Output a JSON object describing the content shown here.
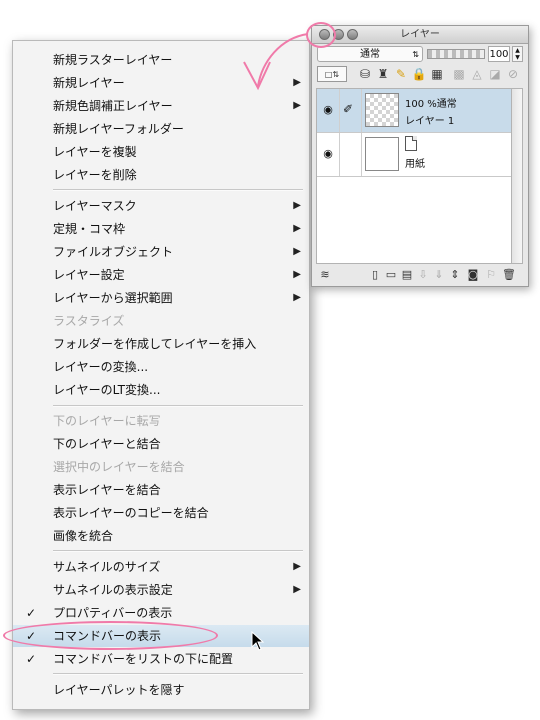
{
  "menu": {
    "items": [
      {
        "label": "新規ラスターレイヤー",
        "submenu": false,
        "disabled": false,
        "checked": false
      },
      {
        "label": "新規レイヤー",
        "submenu": true,
        "disabled": false,
        "checked": false
      },
      {
        "label": "新規色調補正レイヤー",
        "submenu": true,
        "disabled": false,
        "checked": false
      },
      {
        "label": "新規レイヤーフォルダー",
        "submenu": false,
        "disabled": false,
        "checked": false
      },
      {
        "label": "レイヤーを複製",
        "submenu": false,
        "disabled": false,
        "checked": false
      },
      {
        "label": "レイヤーを削除",
        "submenu": false,
        "disabled": false,
        "checked": false
      },
      {
        "label": "レイヤーマスク",
        "submenu": true,
        "disabled": false,
        "checked": false
      },
      {
        "label": "定規・コマ枠",
        "submenu": true,
        "disabled": false,
        "checked": false
      },
      {
        "label": "ファイルオブジェクト",
        "submenu": true,
        "disabled": false,
        "checked": false
      },
      {
        "label": "レイヤー設定",
        "submenu": true,
        "disabled": false,
        "checked": false
      },
      {
        "label": "レイヤーから選択範囲",
        "submenu": true,
        "disabled": false,
        "checked": false
      },
      {
        "label": "ラスタライズ",
        "submenu": false,
        "disabled": true,
        "checked": false
      },
      {
        "label": "フォルダーを作成してレイヤーを挿入",
        "submenu": false,
        "disabled": false,
        "checked": false
      },
      {
        "label": "レイヤーの変換...",
        "submenu": false,
        "disabled": false,
        "checked": false
      },
      {
        "label": "レイヤーのLT変換...",
        "submenu": false,
        "disabled": false,
        "checked": false
      },
      {
        "label": "下のレイヤーに転写",
        "submenu": false,
        "disabled": true,
        "checked": false
      },
      {
        "label": "下のレイヤーと結合",
        "submenu": false,
        "disabled": false,
        "checked": false
      },
      {
        "label": "選択中のレイヤーを結合",
        "submenu": false,
        "disabled": true,
        "checked": false
      },
      {
        "label": "表示レイヤーを結合",
        "submenu": false,
        "disabled": false,
        "checked": false
      },
      {
        "label": "表示レイヤーのコピーを結合",
        "submenu": false,
        "disabled": false,
        "checked": false
      },
      {
        "label": "画像を統合",
        "submenu": false,
        "disabled": false,
        "checked": false
      },
      {
        "label": "サムネイルのサイズ",
        "submenu": true,
        "disabled": false,
        "checked": false
      },
      {
        "label": "サムネイルの表示設定",
        "submenu": true,
        "disabled": false,
        "checked": false
      },
      {
        "label": "プロパティバーの表示",
        "submenu": false,
        "disabled": false,
        "checked": true
      },
      {
        "label": "コマンドバーの表示",
        "submenu": false,
        "disabled": false,
        "checked": true,
        "highlighted": true
      },
      {
        "label": "コマンドバーをリストの下に配置",
        "submenu": false,
        "disabled": false,
        "checked": true
      },
      {
        "label": "レイヤーパレットを隠す",
        "submenu": false,
        "disabled": false,
        "checked": false
      }
    ],
    "arrow_glyph": "▶",
    "check_glyph": "✓"
  },
  "palette": {
    "title": "レイヤー",
    "blend_mode": "通常",
    "opacity": "100",
    "layers": [
      {
        "line1": "100 %通常",
        "line2": "レイヤー 1",
        "selected": true,
        "thumb": "transparent"
      },
      {
        "line1": "",
        "line2": "用紙",
        "selected": false,
        "thumb": "white"
      }
    ]
  },
  "colors": {
    "annotation": "#f07aa9",
    "highlight": "#c6dbeb",
    "disabled_text": "#a8a8a8"
  }
}
